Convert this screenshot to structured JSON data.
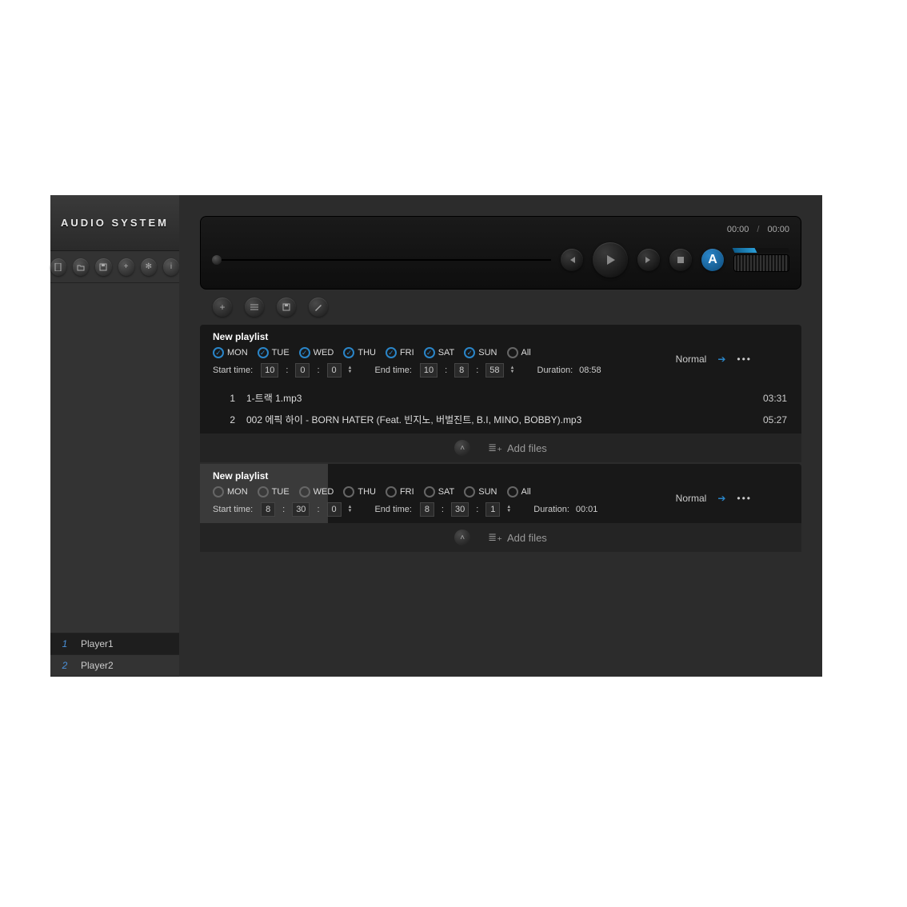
{
  "app": {
    "title": "AUDIO SYSTEM"
  },
  "timebar": {
    "current": "00:00",
    "sep": "/",
    "total": "00:00"
  },
  "controls": {
    "a_label": "A"
  },
  "players": [
    {
      "num": "1",
      "name": "Player1"
    },
    {
      "num": "2",
      "name": "Player2"
    }
  ],
  "pl1": {
    "title": "New playlist",
    "days": {
      "mon": "MON",
      "tue": "TUE",
      "wed": "WED",
      "thu": "THU",
      "fri": "FRI",
      "sat": "SAT",
      "sun": "SUN",
      "all": "All"
    },
    "start_label": "Start time:",
    "end_label": "End time:",
    "start": {
      "h": "10",
      "m": "0",
      "s": "0"
    },
    "end": {
      "h": "10",
      "m": "8",
      "s": "58"
    },
    "duration_label": "Duration:",
    "duration": "08:58",
    "mode": "Normal",
    "tracks": [
      {
        "num": "1",
        "name": "1-트랙 1.mp3",
        "dur": "03:31"
      },
      {
        "num": "2",
        "name": "002 에픽 하이 - BORN HATER (Feat. 빈지노, 버벌진트, B.I, MINO, BOBBY).mp3",
        "dur": "05:27"
      }
    ],
    "addfiles": "Add files"
  },
  "pl2": {
    "title": "New playlist",
    "days": {
      "mon": "MON",
      "tue": "TUE",
      "wed": "WED",
      "thu": "THU",
      "fri": "FRI",
      "sat": "SAT",
      "sun": "SUN",
      "all": "All"
    },
    "start_label": "Start time:",
    "end_label": "End time:",
    "start": {
      "h": "8",
      "m": "30",
      "s": "0"
    },
    "end": {
      "h": "8",
      "m": "30",
      "s": "1"
    },
    "duration_label": "Duration:",
    "duration": "00:01",
    "mode": "Normal",
    "addfiles": "Add files"
  }
}
